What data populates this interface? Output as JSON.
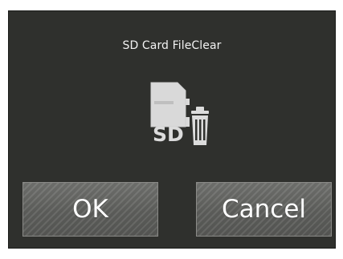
{
  "dialog": {
    "title": "SD Card FileClear",
    "icon": "sd-card-trash-icon",
    "icon_text": "SD",
    "ok_label": "OK",
    "cancel_label": "Cancel"
  },
  "colors": {
    "background": "#2f302d",
    "button": "#666764",
    "text": "#ffffff",
    "icon": "#d8d8d8"
  }
}
